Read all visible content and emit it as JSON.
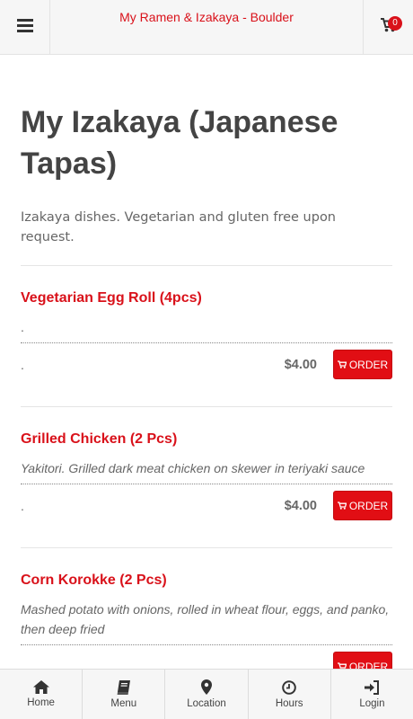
{
  "header": {
    "site_title": "My Ramen & Izakaya - Boulder",
    "cart_count": "0",
    "menu_icon": "hamburger-icon",
    "cart_icon": "shopping-cart-icon"
  },
  "page": {
    "title": "My Izakaya (Japanese Tapas)",
    "description": "Izakaya dishes. Vegetarian and gluten free upon request."
  },
  "items": [
    {
      "name": "Vegetarian Egg Roll (4pcs)",
      "description": ".",
      "size_label": ".",
      "price": "$4.00",
      "order_label": "ORDER"
    },
    {
      "name": "Grilled Chicken (2 Pcs)",
      "description": "Yakitori. Grilled dark meat chicken on skewer in teriyaki sauce",
      "size_label": ".",
      "price": "$4.00",
      "order_label": "ORDER"
    },
    {
      "name": "Corn Korokke (2 Pcs)",
      "description": "Mashed potato with onions, rolled in wheat flour, eggs, and panko, then deep fried",
      "size_label": ".",
      "price": "",
      "order_label": "ORDER"
    }
  ],
  "bottom_nav": [
    {
      "label": "Home",
      "icon": "home-icon"
    },
    {
      "label": "Menu",
      "icon": "book-icon"
    },
    {
      "label": "Location",
      "icon": "map-marker-icon"
    },
    {
      "label": "Hours",
      "icon": "clock-icon"
    },
    {
      "label": "Login",
      "icon": "sign-in-icon"
    }
  ],
  "colors": {
    "accent": "#d9111a",
    "order_button": "#e10e14"
  }
}
